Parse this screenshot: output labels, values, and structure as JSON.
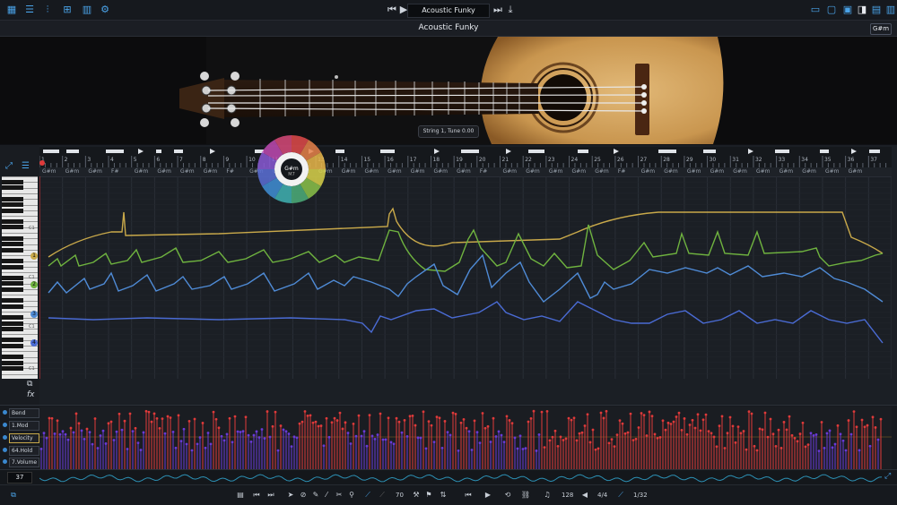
{
  "top": {
    "song_title": "Acoustic Funky",
    "left_icons": [
      "grid-icon",
      "mixer-icon",
      "sliders-icon",
      "grid-split-icon",
      "bars-icon",
      "gear-icon"
    ],
    "right_icons": [
      "layout-a-icon",
      "layout-b-icon",
      "layout-c-icon",
      "layout-d-icon",
      "layout-e-icon",
      "layout-f-icon"
    ]
  },
  "instrument": {
    "title": "Acoustic Funky",
    "key_button": "G#m"
  },
  "guitar": {
    "tooltip": "String 1, Tune 0.00"
  },
  "circle_of_fifths": {
    "center_label": "G#m",
    "center_sub": "M7"
  },
  "ruler": {
    "bars": [
      "1",
      "2",
      "3",
      "4",
      "5",
      "6",
      "7",
      "8",
      "9",
      "10",
      "11",
      "12",
      "13",
      "14",
      "15",
      "16",
      "17",
      "18",
      "19",
      "20",
      "21",
      "22",
      "23",
      "24",
      "25",
      "26",
      "27",
      "28",
      "29",
      "30",
      "31",
      "32",
      "33",
      "34",
      "35",
      "36",
      "37"
    ]
  },
  "chords": [
    "G#m",
    "G#m",
    "G#m",
    "F#",
    "G#m",
    "G#m",
    "G#m",
    "G#m",
    "F#",
    "G#m",
    "G#m",
    "G#m",
    "G#m",
    "G#m",
    "G#m",
    "G#m",
    "G#m",
    "G#m",
    "G#m",
    "F#",
    "G#m",
    "G#m",
    "G#m",
    "G#m",
    "G#m",
    "F#",
    "G#m",
    "G#m",
    "G#m",
    "G#m",
    "G#m",
    "G#m",
    "G#m",
    "G#m",
    "G#m",
    "G#m"
  ],
  "keyboard": {
    "c_labels": [
      "C1",
      "C1",
      "C1",
      "C1"
    ]
  },
  "string_markers": [
    "1",
    "2",
    "3",
    "4"
  ],
  "lanes": [
    {
      "label": "Bend"
    },
    {
      "label": "1.Mod"
    },
    {
      "label": "Velocity"
    },
    {
      "label": "64.Hold"
    },
    {
      "label": "7.Volume"
    }
  ],
  "overview": {
    "bpm_box": "37"
  },
  "bottom": {
    "quantize": "70",
    "tempo": "128",
    "signature": "4/4",
    "grid": "1/32"
  },
  "colors": {
    "accent": "#4aa3e8",
    "string1": "#c9a94a",
    "string2": "#6fb33f",
    "string3": "#4f8bd6",
    "string4": "#4a6bd4",
    "velocity_high": "#e03a3a",
    "velocity_low": "#6a3ad8"
  }
}
